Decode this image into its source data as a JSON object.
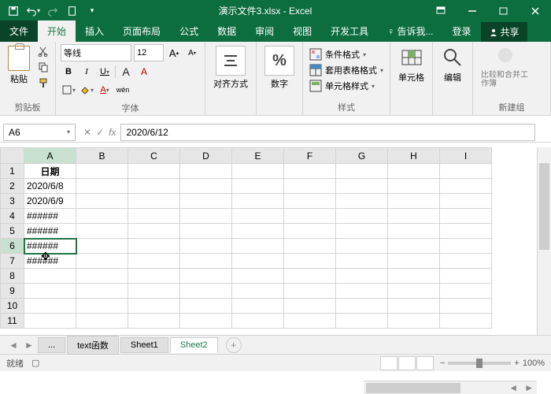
{
  "app": {
    "title": "演示文件3.xlsx - Excel"
  },
  "tabs": {
    "file": "文件",
    "home": "开始",
    "insert": "插入",
    "layout": "页面布局",
    "formulas": "公式",
    "data": "数据",
    "review": "审阅",
    "view": "视图",
    "dev": "开发工具",
    "tellme": "告诉我...",
    "login": "登录",
    "share": "共享"
  },
  "ribbon": {
    "clipboard": {
      "paste": "粘贴",
      "label": "剪贴板"
    },
    "font": {
      "name": "等线",
      "size": "12",
      "label": "字体",
      "b": "B",
      "i": "I",
      "u": "U",
      "a1": "A",
      "a2": "A",
      "wen": "wén"
    },
    "align": {
      "btn": "对齐方式",
      "label": ""
    },
    "number": {
      "btn": "数字",
      "pct": "%",
      "label": ""
    },
    "styles": {
      "cond": "条件格式",
      "table": "套用表格格式",
      "cell": "单元格样式",
      "label": "样式"
    },
    "cells": {
      "btn": "单元格"
    },
    "editing": {
      "btn": "编辑"
    },
    "newgroup": {
      "btn": "比较和合并工作簿",
      "label": "新建组"
    }
  },
  "namebox": "A6",
  "formula": "2020/6/12",
  "columns": [
    "A",
    "B",
    "C",
    "D",
    "E",
    "F",
    "G",
    "H",
    "I"
  ],
  "rows": [
    {
      "n": "1",
      "cells": [
        "日期",
        "",
        "",
        "",
        "",
        "",
        "",
        "",
        ""
      ]
    },
    {
      "n": "2",
      "cells": [
        "2020/6/8",
        "",
        "",
        "",
        "",
        "",
        "",
        "",
        ""
      ]
    },
    {
      "n": "3",
      "cells": [
        "2020/6/9",
        "",
        "",
        "",
        "",
        "",
        "",
        "",
        ""
      ]
    },
    {
      "n": "4",
      "cells": [
        "######",
        "",
        "",
        "",
        "",
        "",
        "",
        "",
        ""
      ]
    },
    {
      "n": "5",
      "cells": [
        "######",
        "",
        "",
        "",
        "",
        "",
        "",
        "",
        ""
      ]
    },
    {
      "n": "6",
      "cells": [
        "######",
        "",
        "",
        "",
        "",
        "",
        "",
        "",
        ""
      ]
    },
    {
      "n": "7",
      "cells": [
        "######",
        "",
        "",
        "",
        "",
        "",
        "",
        "",
        ""
      ]
    },
    {
      "n": "8",
      "cells": [
        "",
        "",
        "",
        "",
        "",
        "",
        "",
        "",
        ""
      ]
    },
    {
      "n": "9",
      "cells": [
        "",
        "",
        "",
        "",
        "",
        "",
        "",
        "",
        ""
      ]
    },
    {
      "n": "10",
      "cells": [
        "",
        "",
        "",
        "",
        "",
        "",
        "",
        "",
        ""
      ]
    },
    {
      "n": "11",
      "cells": [
        "",
        "",
        "",
        "",
        "",
        "",
        "",
        "",
        ""
      ]
    }
  ],
  "sheet_tabs": {
    "ellipsis": "...",
    "t1": "text函数",
    "t2": "Sheet1",
    "t3": "Sheet2"
  },
  "status": {
    "ready": "就绪",
    "rec": "",
    "zoom": "100%"
  },
  "fx": "fx"
}
